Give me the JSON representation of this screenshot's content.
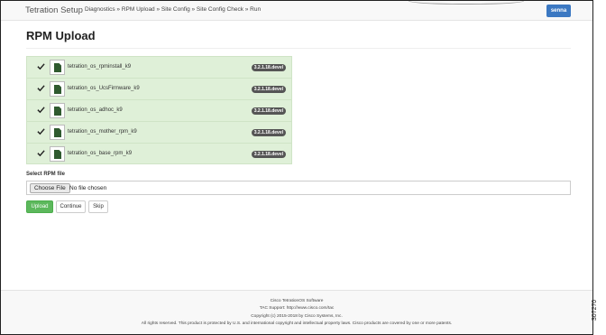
{
  "navbar": {
    "brand": "Tetration Setup",
    "breadcrumb": "Diagnostics » RPM Upload » Site Config » Site Config Check » Run",
    "user_label": "senna"
  },
  "page": {
    "title": "RPM Upload"
  },
  "rpms": [
    {
      "name": "tetration_os_rpminstall_k9",
      "version": "3.2.1.18.devel"
    },
    {
      "name": "tetration_os_UcsFirmware_k9",
      "version": "3.2.1.18.devel"
    },
    {
      "name": "tetration_os_adhoc_k9",
      "version": "3.2.1.18.devel"
    },
    {
      "name": "tetration_os_mother_rpm_k9",
      "version": "3.2.1.18.devel"
    },
    {
      "name": "tetration_os_base_rpm_k9",
      "version": "3.2.1.18.devel"
    }
  ],
  "upload_form": {
    "label": "Select RPM file",
    "choose_label": "Choose File",
    "no_file_text": "No file chosen",
    "upload_label": "Upload",
    "continue_label": "Continue",
    "skip_label": "Skip"
  },
  "footer": {
    "line1": "Cisco TetrationOS Software",
    "line2": "TAC Support: http://www.cisco.com/tac",
    "line3": "Copyright (c) 2015-2018 by Cisco Systems, Inc.",
    "line4": "All rights reserved. This product is protected by U.S. and international copyright and intellectual property laws. Cisco products are covered by one or more patents."
  },
  "side_code": "307270",
  "colors": {
    "success_panel": "#dff0d8",
    "primary": "#3b78c2",
    "upload_green": "#5cb85c",
    "badge": "#555555"
  }
}
